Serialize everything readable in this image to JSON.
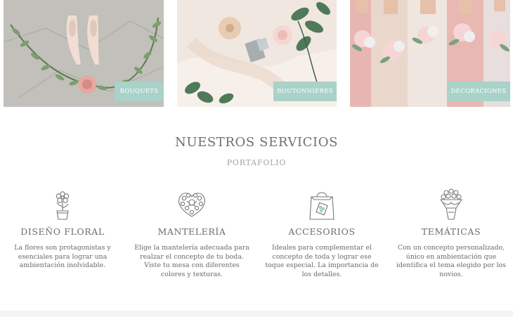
{
  "gallery": {
    "tiles": [
      {
        "label": "BOUQUETS"
      },
      {
        "label": "BOUTONNIERES"
      },
      {
        "label": "DECORACIONES"
      }
    ],
    "accent_color": "#a9d2c9"
  },
  "services": {
    "title": "NUESTROS SERVICIOS",
    "subtitle": "PORTAFOLIO",
    "items": [
      {
        "icon": "flower-pot-icon",
        "name": "DISEÑO FLORAL",
        "description": "La flores son protagonistas y esenciales para lograr una ambientación inolvidable."
      },
      {
        "icon": "heart-wreath-icon",
        "name": "MANTELERÍA",
        "description": "Elige la mantelería adecuada para realzar el concepto de tu boda. Viste tu mesa con diferentes colores y texturas."
      },
      {
        "icon": "gift-bag-icon",
        "name": "ACCESORIOS",
        "description": "Ideales para complementar el concepto de toda y lograr ese toque especial. La importancia de los detalles."
      },
      {
        "icon": "bouquet-icon",
        "name": "TEMÁTICAS",
        "description": "Con un concepto personalizado, único en ambientación que identifica el tema elegido por los novios."
      }
    ]
  }
}
